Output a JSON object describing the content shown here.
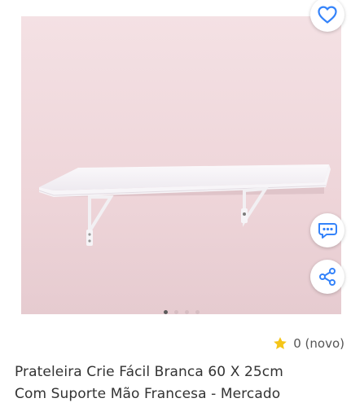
{
  "gallery": {
    "image_description_icon": "shelf-photo",
    "dots_count": 4,
    "active_dot": 0
  },
  "actions": {
    "favorite_icon": "heart-icon",
    "comment_icon": "comment-icon",
    "share_icon": "share-icon",
    "accent_color": "#3483fa"
  },
  "rating": {
    "star_icon": "star-icon",
    "star_color": "#f5c518",
    "text": "0 (novo)"
  },
  "product": {
    "title": "Prateleira Crie Fácil Branca 60 X 25cm\nCom Suporte Mão Francesa - Mercado"
  }
}
